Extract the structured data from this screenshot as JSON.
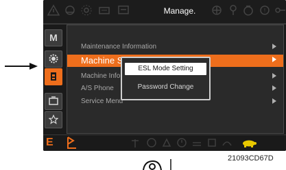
{
  "top_bar": {
    "title": "Manage.",
    "icons": [
      "warning-icon",
      "engine-icon",
      "settings-gear-icon",
      "battery-icon",
      "monitor-icon",
      "target-icon",
      "wrench-icon",
      "filter-icon",
      "brake-icon",
      "circuit-icon"
    ]
  },
  "side_bar": {
    "items": [
      {
        "name": "mode",
        "label": "M"
      },
      {
        "name": "settings",
        "icon": "gear-icon"
      },
      {
        "name": "manage",
        "icon": "manage-icon",
        "active": true
      },
      {
        "name": "display",
        "icon": "display-icon"
      },
      {
        "name": "favorites",
        "icon": "star-icon"
      }
    ]
  },
  "menu": {
    "items": [
      {
        "label": "Maintenance Information"
      },
      {
        "label": "Machine S",
        "selected": true
      },
      {
        "label": "Machine Info"
      },
      {
        "label": "A/S Phone"
      },
      {
        "label": "Service Menu"
      }
    ]
  },
  "popup": {
    "items": [
      {
        "label": "ESL Mode Setting",
        "selected": true
      },
      {
        "label": "Password Change"
      }
    ]
  },
  "bottom_bar": {
    "mode_label": "E",
    "icons": [
      "flag-icon",
      "antenna-icon",
      "power-mode-icon",
      "work-mode-icon",
      "clock-icon",
      "travel-icon",
      "fan-icon",
      "speed-icon",
      "turtle-icon"
    ]
  },
  "figure_id": "21093CD67D",
  "colors": {
    "accent": "#ee6e1c",
    "panel": "#2a2a2a",
    "text_dim": "#a8a8a8"
  }
}
